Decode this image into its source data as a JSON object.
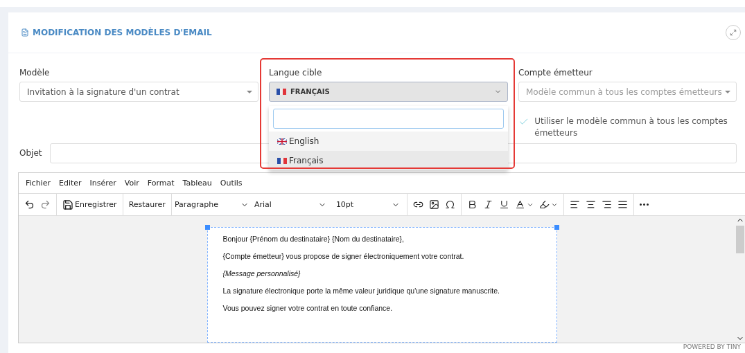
{
  "header": {
    "title": "MODIFICATION DES MODÈLES D'EMAIL"
  },
  "fields": {
    "model": {
      "label": "Modèle",
      "value": "Invitation à la signature d'un contrat"
    },
    "language": {
      "label": "Langue cible",
      "value": "FRANÇAIS",
      "expanded": true,
      "highlighted": true,
      "options": [
        {
          "label": "English",
          "kind": "uk",
          "selected": false
        },
        {
          "label": "Français",
          "kind": "fr",
          "selected": true
        }
      ]
    },
    "sender": {
      "label": "Compte émetteur",
      "placeholder": "Modèle commun à tous les comptes émetteurs"
    },
    "use_common": {
      "label": "Utiliser le modèle commun à tous les comptes émetteurs",
      "checked": true
    },
    "subject": {
      "label": "Objet"
    }
  },
  "editor": {
    "menu": [
      "Fichier",
      "Editer",
      "Insérer",
      "Voir",
      "Format",
      "Tableau",
      "Outils"
    ],
    "save": "Enregistrer",
    "restore": "Restaurer",
    "block": "Paragraphe",
    "font": "Arial",
    "size": "10pt",
    "paragraphs": [
      {
        "text": "Bonjour {Prénom du destinataire} {Nom du destinataire},",
        "italic": false
      },
      {
        "text": "{Compte émetteur} vous propose de signer électroniquement votre contrat.",
        "italic": false
      },
      {
        "text": "{Message personnalisé}",
        "italic": true
      },
      {
        "text": "La signature électronique porte la même valeur juridique qu'une signature manuscrite.",
        "italic": false
      },
      {
        "text": "Vous pouvez signer votre contrat en toute confiance.",
        "italic": false
      }
    ],
    "status": "POWERED BY TINY"
  }
}
